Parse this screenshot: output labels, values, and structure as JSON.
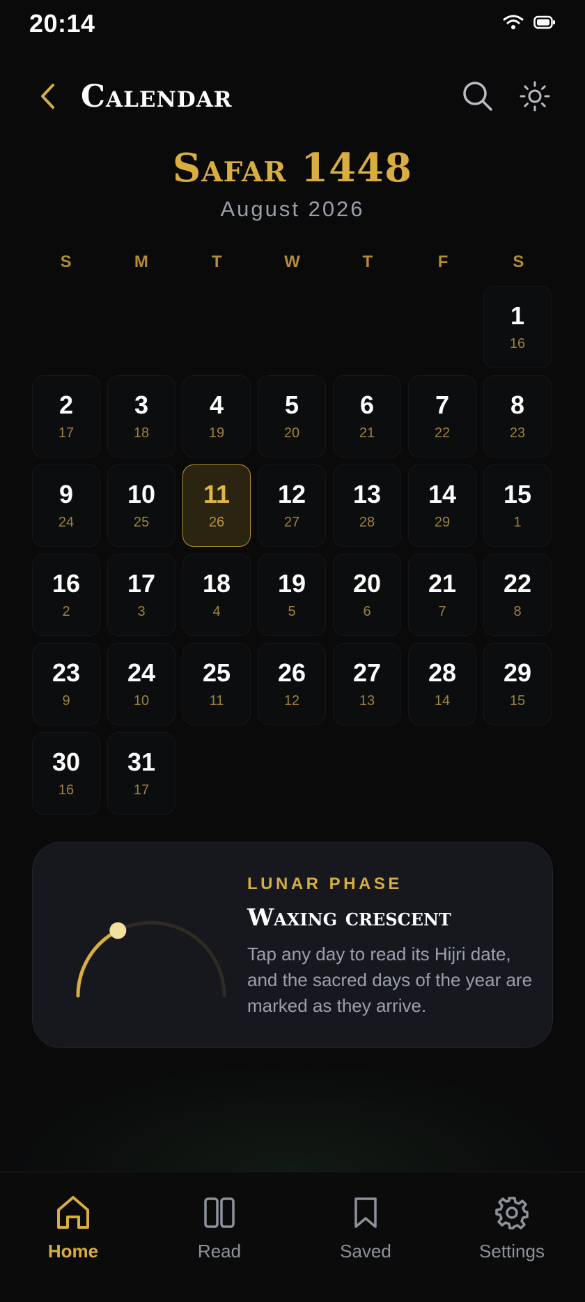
{
  "status": {
    "time": "20:14"
  },
  "header": {
    "title": "Calendar"
  },
  "month": {
    "hijri": "Safar 1448",
    "gregorian": "August 2026"
  },
  "weekdays": [
    "S",
    "M",
    "T",
    "W",
    "T",
    "F",
    "S"
  ],
  "days": [
    {
      "g": "",
      "h": ""
    },
    {
      "g": "",
      "h": ""
    },
    {
      "g": "",
      "h": ""
    },
    {
      "g": "",
      "h": ""
    },
    {
      "g": "",
      "h": ""
    },
    {
      "g": "",
      "h": ""
    },
    {
      "g": "1",
      "h": "16"
    },
    {
      "g": "2",
      "h": "17"
    },
    {
      "g": "3",
      "h": "18"
    },
    {
      "g": "4",
      "h": "19"
    },
    {
      "g": "5",
      "h": "20"
    },
    {
      "g": "6",
      "h": "21"
    },
    {
      "g": "7",
      "h": "22"
    },
    {
      "g": "8",
      "h": "23"
    },
    {
      "g": "9",
      "h": "24"
    },
    {
      "g": "10",
      "h": "25"
    },
    {
      "g": "11",
      "h": "26",
      "today": true
    },
    {
      "g": "12",
      "h": "27"
    },
    {
      "g": "13",
      "h": "28"
    },
    {
      "g": "14",
      "h": "29"
    },
    {
      "g": "15",
      "h": "1"
    },
    {
      "g": "16",
      "h": "2"
    },
    {
      "g": "17",
      "h": "3"
    },
    {
      "g": "18",
      "h": "4"
    },
    {
      "g": "19",
      "h": "5"
    },
    {
      "g": "20",
      "h": "6"
    },
    {
      "g": "21",
      "h": "7"
    },
    {
      "g": "22",
      "h": "8"
    },
    {
      "g": "23",
      "h": "9"
    },
    {
      "g": "24",
      "h": "10"
    },
    {
      "g": "25",
      "h": "11"
    },
    {
      "g": "26",
      "h": "12"
    },
    {
      "g": "27",
      "h": "13"
    },
    {
      "g": "28",
      "h": "14"
    },
    {
      "g": "29",
      "h": "15"
    },
    {
      "g": "30",
      "h": "16"
    },
    {
      "g": "31",
      "h": "17"
    }
  ],
  "lunar": {
    "label": "LUNAR PHASE",
    "phase": "Waxing crescent",
    "description": "Tap any day to read its Hijri date, and the sacred days of the year are marked as they arrive.",
    "progress": 0.35
  },
  "nav": [
    {
      "label": "Home",
      "icon": "home-icon",
      "active": true
    },
    {
      "label": "Read",
      "icon": "book-icon",
      "active": false
    },
    {
      "label": "Saved",
      "icon": "bookmark-icon",
      "active": false
    },
    {
      "label": "Settings",
      "icon": "gear-icon",
      "active": false
    }
  ],
  "colors": {
    "accent": "#d9ad3e",
    "background": "#0a0a0b",
    "card": "#16181e",
    "muted": "#9aa0ab"
  }
}
